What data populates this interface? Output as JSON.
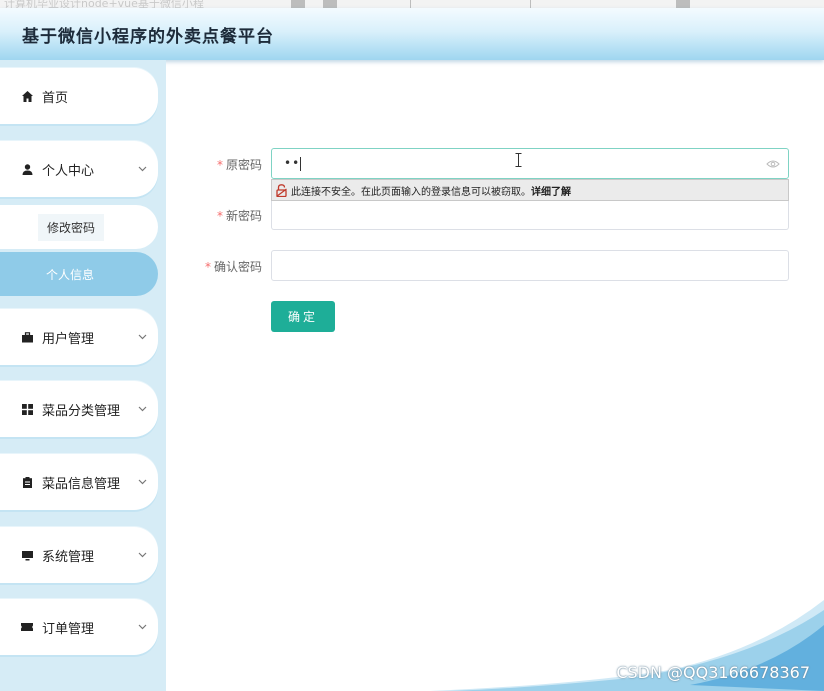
{
  "top_strip": {
    "ghost_text": "计算机毕业设计node+vue基于微信小程"
  },
  "header": {
    "title": "基于微信小程序的外卖点餐平台"
  },
  "sidebar": {
    "items": [
      {
        "label": "首页",
        "icon": "home-icon"
      },
      {
        "label": "个人中心",
        "icon": "user-icon",
        "expanded": true,
        "children": [
          {
            "label": "修改密码",
            "active": false
          },
          {
            "label": "个人信息",
            "active": true
          }
        ]
      },
      {
        "label": "用户管理",
        "icon": "briefcase-icon"
      },
      {
        "label": "菜品分类管理",
        "icon": "grid-icon"
      },
      {
        "label": "菜品信息管理",
        "icon": "clipboard-icon"
      },
      {
        "label": "系统管理",
        "icon": "monitor-icon"
      },
      {
        "label": "订单管理",
        "icon": "ticket-icon"
      }
    ]
  },
  "form": {
    "old_password": {
      "label": "原密码",
      "required_mark": "*",
      "value": "••"
    },
    "new_password": {
      "label": "新密码",
      "required_mark": "*",
      "value": ""
    },
    "confirm_password": {
      "label": "确认密码",
      "required_mark": "*",
      "value": ""
    },
    "submit_label": "确定"
  },
  "security_warning": {
    "text": "此连接不安全。在此页面输入的登录信息可以被窃取。",
    "link": "详细了解"
  },
  "watermark": "CSDN @QQ3166678367",
  "colors": {
    "accent": "#1eae98",
    "sidebar_bg": "#d6ecf6",
    "active_sub": "#8fcbe8",
    "required": "#f56c6c"
  }
}
